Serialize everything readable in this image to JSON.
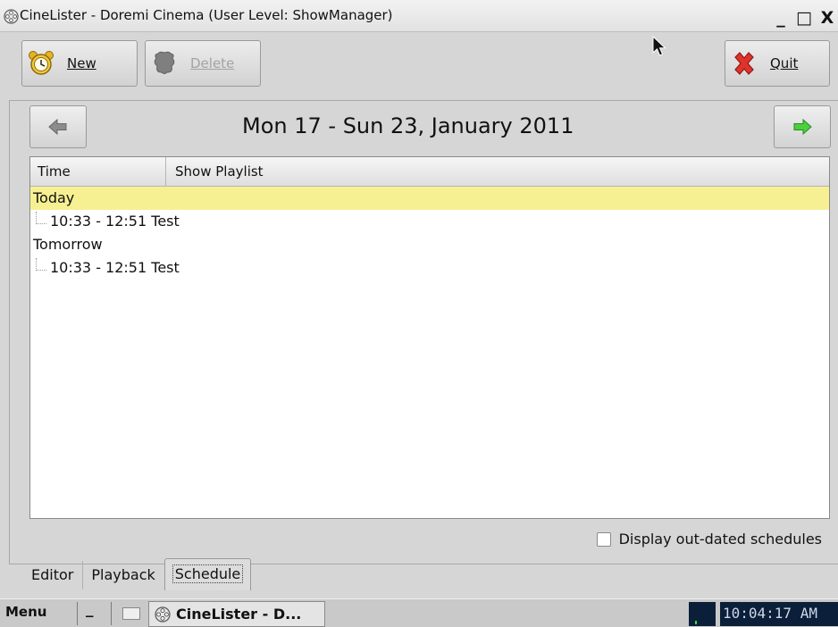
{
  "window": {
    "title": "CineLister - Doremi Cinema (User Level: ShowManager)",
    "controls": {
      "minimize": "_",
      "maximize": "□",
      "close": "X"
    }
  },
  "toolbar": {
    "new_label": "New",
    "new_icon": "alarm-clock-icon",
    "delete_label": "Delete",
    "delete_icon": "delete-icon",
    "quit_label": "Quit",
    "quit_icon": "red-x-icon"
  },
  "schedule": {
    "week_title": "Mon 17 - Sun 23, January 2011",
    "prev_icon": "arrow-left-icon",
    "next_icon": "arrow-right-icon",
    "columns": [
      "Time",
      "Show Playlist"
    ],
    "groups": [
      {
        "label": "Today",
        "selected": true,
        "entries": [
          {
            "time": "10:33 - 12:51",
            "playlist": "Test"
          }
        ]
      },
      {
        "label": "Tomorrow",
        "selected": false,
        "entries": [
          {
            "time": "10:33 - 12:51",
            "playlist": "Test"
          }
        ]
      }
    ],
    "outdated_checkbox": {
      "label": "Display out-dated schedules",
      "checked": false
    }
  },
  "tabs": [
    {
      "label": "Editor",
      "active": false
    },
    {
      "label": "Playback",
      "active": false
    },
    {
      "label": "Schedule",
      "active": true
    }
  ],
  "taskbar": {
    "menu_label": "Menu",
    "minimize_label": "_",
    "task_label": "CineLister - D...",
    "clock": "10:04:17 AM"
  },
  "colors": {
    "selected_row": "#f7f093",
    "background": "#d6d6d6",
    "clock_background": "#0c1f3a"
  }
}
